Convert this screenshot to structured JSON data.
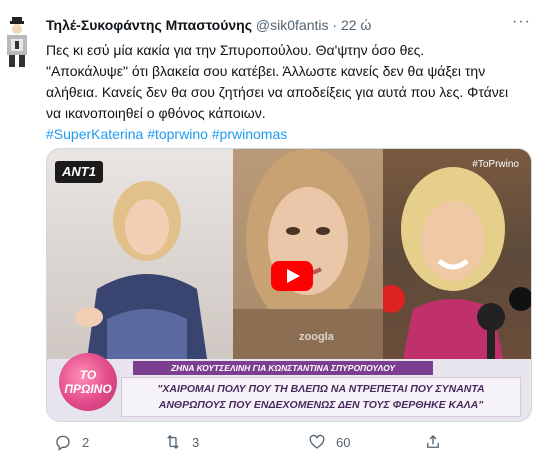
{
  "author": {
    "display_name": "Τηλέ-Συκοφάντης Μπαστούνης",
    "handle": "@sik0fantis",
    "separator": "·",
    "time": "22 ώ"
  },
  "tweet": {
    "lines": [
      "Πες κι εσύ μία κακία για την Σπυροπούλου. Θα'ψτην όσο θες.",
      "\"Αποκάλυψε\" ότι βλακεία σου κατέβει. Άλλωστε κανείς δεν θα ψάξει την",
      "αλήθεια. Κανείς δεν θα σου ζητήσει να αποδείξεις για αυτά που λες. Φτάνει",
      "να ικανοποιηθεί ο φθόνος κάποιων."
    ],
    "hashtags": [
      "#SuperKaterina",
      "#toprwino",
      "#prwinomas"
    ]
  },
  "media": {
    "channel_logo": "ANT1",
    "corner_tag": "#ToPrwino",
    "watermark": "zoogla",
    "show_logo": "TO ΠΡΩΙΝΟ",
    "banner_top": "ΖΗΝΑ ΚΟΥΤΣΕΛΙΝΗ ΓΙΑ ΚΩΝΣΤΑΝΤΙΝΑ ΣΠΥΡΟΠΟΥΛΟΥ",
    "banner_line1": "\"ΧΑΙΡΟΜΑΙ ΠΟΛΥ ΠΟΥ ΤΗ ΒΛΕΠΩ ΝΑ ΝΤΡΕΠΕΤΑΙ ΠΟΥ ΣΥΝΑΝΤΑ",
    "banner_line2": "ΑΝΘΡΩΠΟΥΣ ΠΟΥ ΕΝΔΕΧΟΜΕΝΩΣ ΔΕΝ ΤΟΥΣ ΦΕΡΘΗΚΕ ΚΑΛΑ\""
  },
  "actions": {
    "reply_count": "2",
    "retweet_count": "3",
    "like_count": "60"
  },
  "more_label": "···",
  "icons": [
    "avatar",
    "more-icon",
    "play-icon",
    "reply-icon",
    "retweet-icon",
    "like-icon",
    "share-icon"
  ],
  "colors": {
    "link": "#1d9bf0",
    "secondary_text": "#536471",
    "play_button": "#ff0000"
  }
}
